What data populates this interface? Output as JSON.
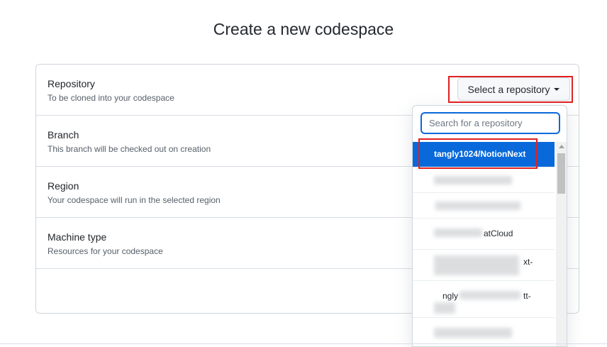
{
  "page": {
    "title": "Create a new codespace"
  },
  "settings": {
    "rows": [
      {
        "label": "Repository",
        "description": "To be cloned into your codespace"
      },
      {
        "label": "Branch",
        "description": "This branch will be checked out on creation"
      },
      {
        "label": "Region",
        "description": "Your codespace will run in the selected region"
      },
      {
        "label": "Machine type",
        "description": "Resources for your codespace"
      }
    ]
  },
  "repository_select": {
    "label": "Select a repository"
  },
  "dropdown": {
    "search_placeholder": "Search for a repository",
    "items": [
      {
        "text": "tangly1024/NotionNext",
        "selected": true
      },
      {
        "text": ""
      },
      {
        "text": ""
      },
      {
        "text": "atCloud"
      },
      {
        "text": "xt-"
      },
      {
        "text": "ngly"
      },
      {
        "text": "tt-"
      },
      {
        "text": ""
      }
    ]
  },
  "colors": {
    "accent": "#0969da",
    "highlight": "#e02020"
  }
}
